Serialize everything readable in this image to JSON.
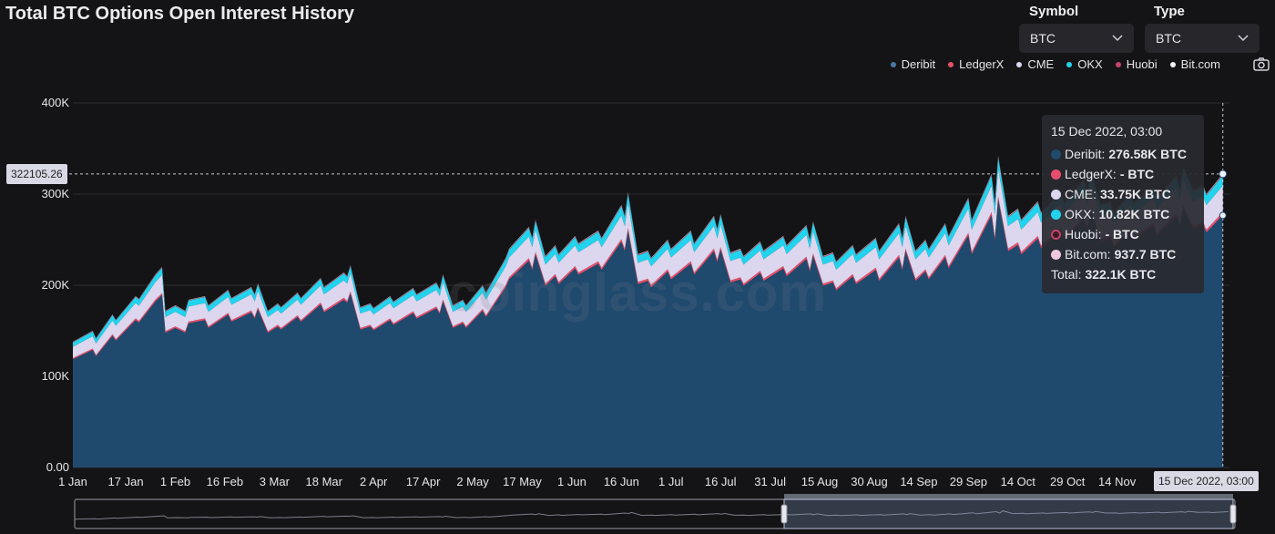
{
  "header": {
    "title": "Total BTC Options Open Interest History",
    "symbol_label": "Symbol",
    "symbol_value": "BTC",
    "type_label": "Type",
    "type_value": "BTC"
  },
  "watermark": "coinglass.com",
  "legend": [
    {
      "name": "Deribit",
      "color": "#1f4a6e"
    },
    {
      "name": "LedgerX",
      "color": "#e84e6c"
    },
    {
      "name": "CME",
      "color": "#dcd6ee"
    },
    {
      "name": "OKX",
      "color": "#22d3ee"
    },
    {
      "name": "Huobi",
      "color": "#c8426a"
    },
    {
      "name": "Bit.com",
      "color": "#f2f2f6"
    }
  ],
  "tooltip": {
    "date": "15 Dec 2022, 03:00",
    "rows": [
      {
        "name": "Deribit:",
        "value": "276.58K BTC",
        "color": "#1f4a6e"
      },
      {
        "name": "LedgerX:",
        "value": "- BTC",
        "color": "#e84e6c"
      },
      {
        "name": "CME:",
        "value": "33.75K BTC",
        "color": "#dcd6ee"
      },
      {
        "name": "OKX:",
        "value": "10.82K BTC",
        "color": "#22d3ee"
      },
      {
        "name": "Huobi:",
        "value": "- BTC",
        "color": "#c8426a"
      },
      {
        "name": "Bit.com:",
        "value": "937.7 BTC",
        "color": "#f0c8dc"
      }
    ],
    "total_label": "Total:",
    "total_value": "322.1K BTC"
  },
  "crosshair": {
    "y_value_label": "322105.26",
    "x_value_label": "15 Dec 2022, 03:00"
  },
  "chart_data": {
    "type": "area",
    "stacked": true,
    "ylim": [
      0,
      400000
    ],
    "y_ticks": [
      "0.00",
      "100K",
      "200K",
      "300K",
      "400K"
    ],
    "x_tick_labels": [
      "1 Jan",
      "17 Jan",
      "1 Feb",
      "16 Feb",
      "3 Mar",
      "18 Mar",
      "2 Apr",
      "17 Apr",
      "2 May",
      "17 May",
      "1 Jun",
      "16 Jun",
      "1 Jul",
      "16 Jul",
      "31 Jul",
      "15 Aug",
      "30 Aug",
      "14 Sep",
      "29 Sep",
      "14 Oct",
      "29 Oct",
      "14 Nov",
      "29"
    ],
    "x_day_index": [
      0,
      16,
      31,
      46,
      61,
      76,
      91,
      106,
      121,
      136,
      151,
      166,
      181,
      196,
      211,
      226,
      241,
      256,
      271,
      286,
      301,
      316,
      331
    ],
    "x_domain_days": [
      0,
      350
    ],
    "total_series": {
      "name": "Total",
      "day": [
        0,
        6,
        7,
        12,
        13,
        19,
        20,
        25,
        26,
        27,
        28,
        31,
        34,
        35,
        40,
        41,
        47,
        48,
        54,
        55,
        56,
        59,
        62,
        63,
        68,
        69,
        75,
        76,
        82,
        83,
        84,
        87,
        90,
        91,
        96,
        97,
        103,
        104,
        110,
        111,
        112,
        115,
        118,
        119,
        124,
        125,
        131,
        132,
        138,
        139,
        140,
        143,
        146,
        147,
        152,
        153,
        159,
        160,
        166,
        167,
        168,
        171,
        174,
        175,
        180,
        181,
        187,
        188,
        194,
        195,
        196,
        199,
        202,
        203,
        208,
        209,
        215,
        216,
        222,
        223,
        224,
        227,
        230,
        231,
        236,
        237,
        243,
        244,
        250,
        251,
        252,
        255,
        258,
        259,
        264,
        265,
        271,
        272,
        278,
        279,
        280,
        283,
        286,
        287,
        292,
        293,
        299,
        300,
        306,
        307,
        308,
        311,
        314,
        315,
        320,
        321,
        327,
        328,
        334,
        335,
        336,
        339,
        342,
        343,
        348
      ],
      "values": [
        138000,
        150000,
        142000,
        168000,
        162000,
        188000,
        185000,
        212000,
        216000,
        220000,
        172000,
        178000,
        172000,
        184000,
        188000,
        178000,
        195000,
        186000,
        198000,
        190000,
        202000,
        172000,
        180000,
        176000,
        192000,
        186000,
        208000,
        198000,
        214000,
        210000,
        222000,
        176000,
        180000,
        175000,
        188000,
        182000,
        197000,
        190000,
        203000,
        196000,
        212000,
        178000,
        184000,
        178000,
        200000,
        192000,
        230000,
        240000,
        264000,
        252000,
        272000,
        232000,
        244000,
        234000,
        254000,
        246000,
        260000,
        252000,
        288000,
        276000,
        302000,
        234000,
        238000,
        230000,
        250000,
        240000,
        260000,
        246000,
        276000,
        262000,
        278000,
        236000,
        240000,
        232000,
        248000,
        238000,
        254000,
        244000,
        266000,
        250000,
        270000,
        232000,
        236000,
        226000,
        244000,
        234000,
        252000,
        238000,
        268000,
        252000,
        276000,
        238000,
        250000,
        240000,
        268000,
        254000,
        296000,
        272000,
        322000,
        290000,
        342000,
        276000,
        284000,
        272000,
        292000,
        280000,
        302000,
        290000,
        316000,
        302000,
        326000,
        288000,
        292000,
        280000,
        300000,
        290000,
        308000,
        296000,
        320000,
        306000,
        330000,
        304000,
        310000,
        300000,
        322105
      ]
    },
    "series_shares": {
      "Deribit": 0.86,
      "LedgerX": 0.01,
      "CME": 0.09,
      "OKX": 0.035,
      "Huobi": 0.003,
      "Bit.com": 0.002
    },
    "hovered_point": {
      "day": 348,
      "Deribit": 276580,
      "LedgerX": null,
      "CME": 33750,
      "OKX": 10820,
      "Huobi": null,
      "Bit.com": 937.7,
      "Total": 322100
    }
  },
  "colors": {
    "background": "#141416",
    "grid": "#2c2c33",
    "axis_text": "#e6e6ea"
  }
}
